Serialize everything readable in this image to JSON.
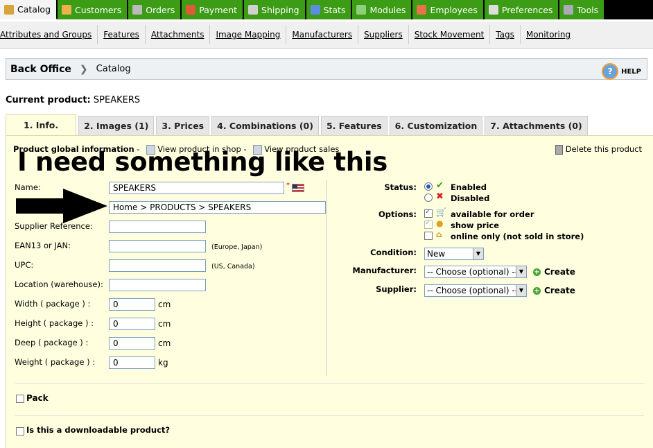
{
  "topnav": {
    "tabs": [
      {
        "label": "Catalog",
        "active": true,
        "icon": "catalog-icon"
      },
      {
        "label": "Customers",
        "icon": "customers-icon"
      },
      {
        "label": "Orders",
        "icon": "orders-icon"
      },
      {
        "label": "Payment",
        "icon": "payment-icon"
      },
      {
        "label": "Shipping",
        "icon": "shipping-icon"
      },
      {
        "label": "Stats",
        "icon": "stats-icon"
      },
      {
        "label": "Modules",
        "icon": "modules-icon"
      },
      {
        "label": "Employees",
        "icon": "employees-icon"
      },
      {
        "label": "Preferences",
        "icon": "preferences-icon"
      },
      {
        "label": "Tools",
        "icon": "tools-icon"
      }
    ],
    "accent": "#3c9c15"
  },
  "subnav": {
    "items": [
      "Attributes and Groups",
      "Features",
      "Attachments",
      "Image Mapping",
      "Manufacturers",
      "Suppliers",
      "Stock Movement",
      "Tags",
      "Monitoring"
    ]
  },
  "breadcrumb": {
    "root": "Back Office",
    "current": "Catalog",
    "help": "HELP"
  },
  "current_product": {
    "label": "Current product:",
    "name": "SPEAKERS"
  },
  "product_tabs": [
    "1. Info.",
    "2. Images (1)",
    "3. Prices",
    "4. Combinations (0)",
    "5. Features",
    "6. Customization",
    "7. Attachments (0)"
  ],
  "info": {
    "global_title": "Product global information",
    "view_in_shop": "View product in shop",
    "view_sales": "View product sales",
    "delete": "Delete this product",
    "overlay_text": "I need something like this",
    "fields": {
      "name_label": "Name:",
      "name_value": "SPEAKERS",
      "required_mark": "*",
      "category_value": "Home > PRODUCTS > SPEAKERS",
      "supplier_ref_label": "Supplier Reference:",
      "ean_label": "EAN13 or JAN:",
      "ean_note": "(Europe, Japan)",
      "upc_label": "UPC:",
      "upc_note": "(US, Canada)",
      "location_label": "Location (warehouse):",
      "width_label": "Width ( package ) :",
      "width_value": "0",
      "height_label": "Height ( package ) :",
      "height_value": "0",
      "deep_label": "Deep ( package ) :",
      "deep_value": "0",
      "weight_label": "Weight ( package ) :",
      "weight_value": "0",
      "unit_cm": "cm",
      "unit_kg": "kg"
    },
    "right": {
      "status_label": "Status:",
      "enabled": "Enabled",
      "disabled": "Disabled",
      "options_label": "Options:",
      "opt_available": "available for order",
      "opt_show_price": "show price",
      "opt_online_only": "online only (not sold in store)",
      "condition_label": "Condition:",
      "condition_value": "New",
      "manufacturer_label": "Manufacturer:",
      "manufacturer_value": "-- Choose (optional) --",
      "supplier_label": "Supplier:",
      "supplier_value": "-- Choose (optional) --",
      "create": "Create"
    },
    "pack_label": "Pack",
    "downloadable_label": "Is this a downloadable product?"
  }
}
